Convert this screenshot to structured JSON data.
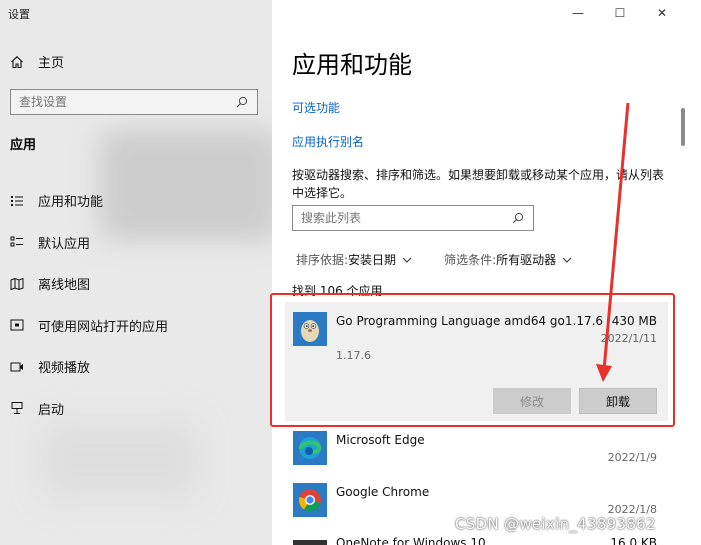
{
  "window": {
    "title": "设置",
    "controls": {
      "minimize": "—",
      "maximize": "☐",
      "close": "✕"
    }
  },
  "sidebar": {
    "home_label": "主页",
    "search_placeholder": "查找设置",
    "section_title": "应用",
    "items": [
      {
        "label": "应用和功能",
        "icon": "apps-features-icon"
      },
      {
        "label": "默认应用",
        "icon": "default-apps-icon"
      },
      {
        "label": "离线地图",
        "icon": "offline-maps-icon"
      },
      {
        "label": "可使用网站打开的应用",
        "icon": "apps-for-websites-icon"
      },
      {
        "label": "视频播放",
        "icon": "video-playback-icon"
      },
      {
        "label": "启动",
        "icon": "startup-icon"
      }
    ]
  },
  "main": {
    "title": "应用和功能",
    "links": [
      "可选功能",
      "应用执行别名"
    ],
    "description": "按驱动器搜索、排序和筛选。如果想要卸载或移动某个应用，请从列表中选择它。",
    "search_placeholder": "搜索此列表",
    "sort_label": "排序依据:",
    "sort_value": "安装日期",
    "filter_label": "筛选条件:",
    "filter_value": "所有驱动器",
    "count_text": "找到 106 个应用"
  },
  "apps": [
    {
      "name": "Go Programming Language amd64 go1.17.6",
      "size": "430 MB",
      "date": "2022/1/11",
      "version": "1.17.6",
      "modify_label": "修改",
      "uninstall_label": "卸载"
    },
    {
      "name": "Microsoft Edge",
      "size": "",
      "date": "2022/1/9"
    },
    {
      "name": "Google Chrome",
      "size": "",
      "date": "2022/1/8"
    },
    {
      "name": "OneNote for Windows 10",
      "size": "16.0 KB",
      "date": ""
    }
  ],
  "watermark": "CSDN @weixin_43893862",
  "colors": {
    "accent": "#0a63c7",
    "annotation": "#e8312a"
  }
}
